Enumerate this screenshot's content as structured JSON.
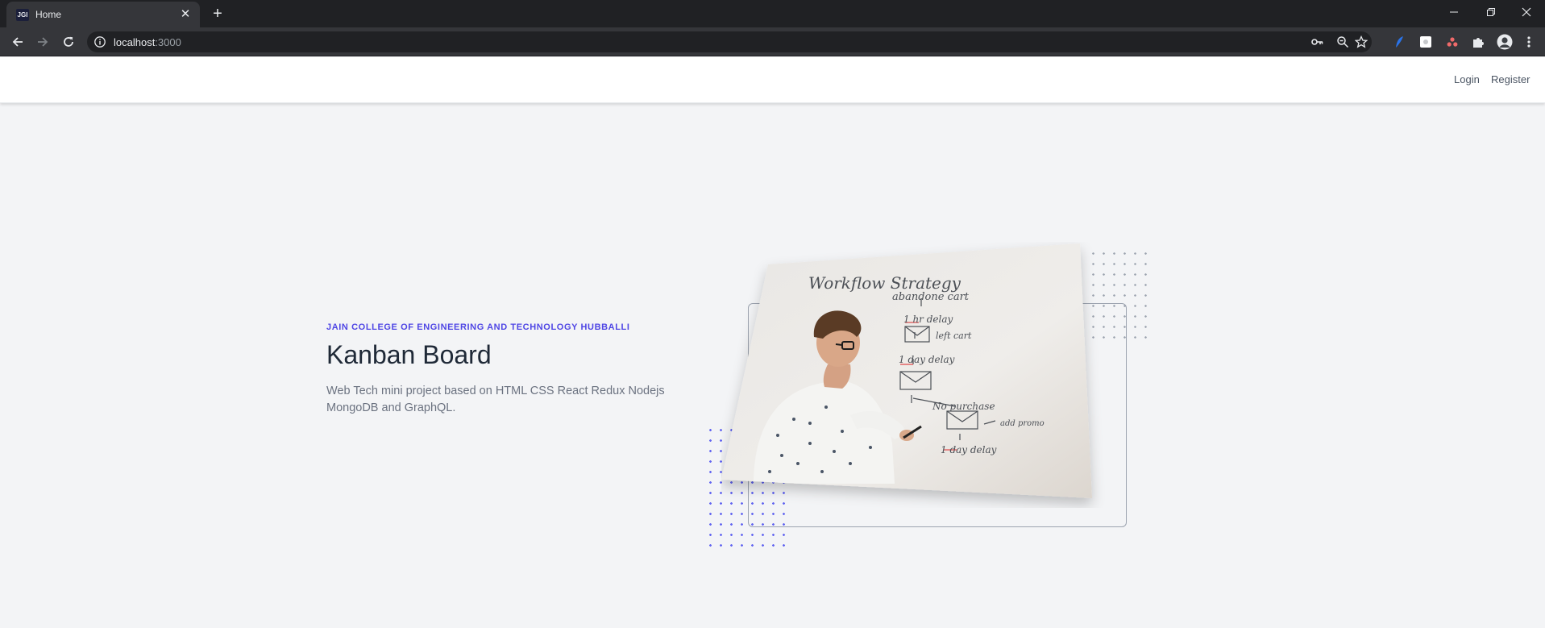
{
  "browser": {
    "tab_title": "Home",
    "favicon_text": "JGI",
    "url_host": "localhost",
    "url_port": ":3000"
  },
  "navbar": {
    "login_label": "Login",
    "register_label": "Register"
  },
  "hero": {
    "eyebrow": "JAIN COLLEGE OF ENGINEERING AND TECHNOLOGY HUBBALLI",
    "title": "Kanban Board",
    "description": "Web Tech mini project based on HTML CSS React Redux Nodejs MongoDB and GraphQL."
  },
  "illustration": {
    "whiteboard": {
      "title": "Workflow Strategy",
      "step_1": "abandone cart",
      "step_2": "1 hr delay",
      "step_3": "left cart",
      "step_4": "1 day delay",
      "step_5": "No purchase",
      "step_6": "add promo",
      "step_7": "1 day delay"
    }
  },
  "colors": {
    "accent": "#4f46e5",
    "background": "#f3f4f6",
    "title": "#1f2937"
  }
}
